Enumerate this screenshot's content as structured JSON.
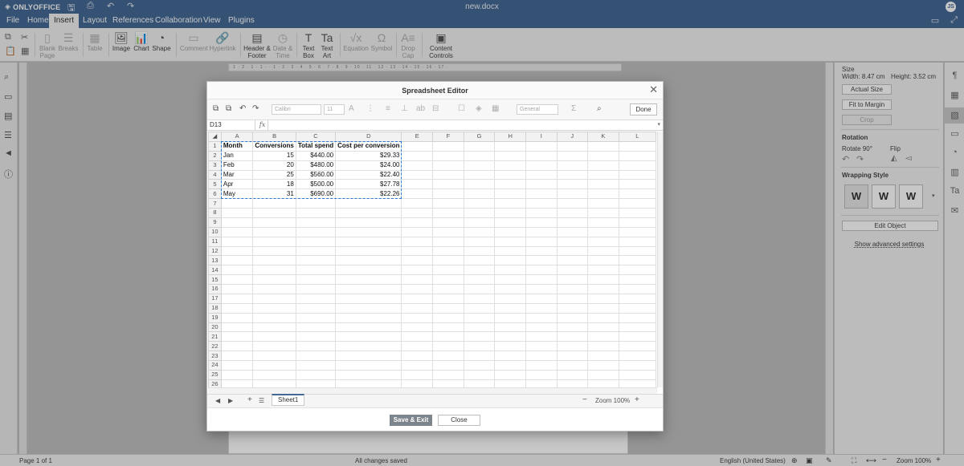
{
  "app": {
    "brand": "ONLYOFFICE",
    "document_title": "new.docx",
    "user_initials": "JS"
  },
  "menu": {
    "tabs": [
      "File",
      "Home",
      "Insert",
      "Layout",
      "References",
      "Collaboration",
      "View",
      "Plugins"
    ],
    "active": "Insert"
  },
  "toolbar": {
    "blank_page": "Blank Page",
    "breaks": "Breaks",
    "table": "Table",
    "image": "Image",
    "chart": "Chart",
    "shape": "Shape",
    "comment": "Comment",
    "hyperlink": "Hyperlink",
    "header_footer": "Header & Footer",
    "date_time": "Date & Time",
    "text_box": "Text Box",
    "text_art": "Text Art",
    "equation": "Equation",
    "symbol": "Symbol",
    "drop_cap": "Drop Cap",
    "content_controls": "Content Controls"
  },
  "right_panel": {
    "size_header": "Size",
    "width_label": "Width: 8.47 cm",
    "height_label": "Height: 3.52 cm",
    "actual_size": "Actual Size",
    "fit_to_margin": "Fit to Margin",
    "crop": "Crop",
    "rotation_header": "Rotation",
    "rotate_label": "Rotate 90°",
    "flip_label": "Flip",
    "wrapping_header": "Wrapping Style",
    "edit_object": "Edit Object",
    "advanced": "Show advanced settings"
  },
  "status": {
    "page": "Page 1 of 1",
    "saved": "All changes saved",
    "language": "English (United States)",
    "zoom": "Zoom 100%"
  },
  "modal": {
    "title": "Spreadsheet Editor",
    "done": "Done",
    "font": "Calibri",
    "font_size": "11",
    "number_format": "General",
    "cell_ref": "D13",
    "fx": "fx",
    "sheet_name": "Sheet1",
    "zoom": "Zoom 100%",
    "save_exit": "Save & Exit",
    "close": "Close",
    "columns": [
      "A",
      "B",
      "C",
      "D",
      "E",
      "F",
      "G",
      "H",
      "I",
      "J",
      "K",
      "L"
    ],
    "rows": [
      [
        "Month",
        "Conversions",
        "Total spend",
        "Cost per conversion"
      ],
      [
        "Jan",
        "15",
        "$440.00",
        "$29.33"
      ],
      [
        "Feb",
        "20",
        "$480.00",
        "$24.00"
      ],
      [
        "Mar",
        "25",
        "$560.00",
        "$22.40"
      ],
      [
        "Apr",
        "18",
        "$500.00",
        "$27.78"
      ],
      [
        "May",
        "31",
        "$690.00",
        "$22.26"
      ]
    ],
    "row_count": 26
  },
  "colors": {
    "header_blue": "#446995",
    "selection": "#2d7bd1"
  }
}
